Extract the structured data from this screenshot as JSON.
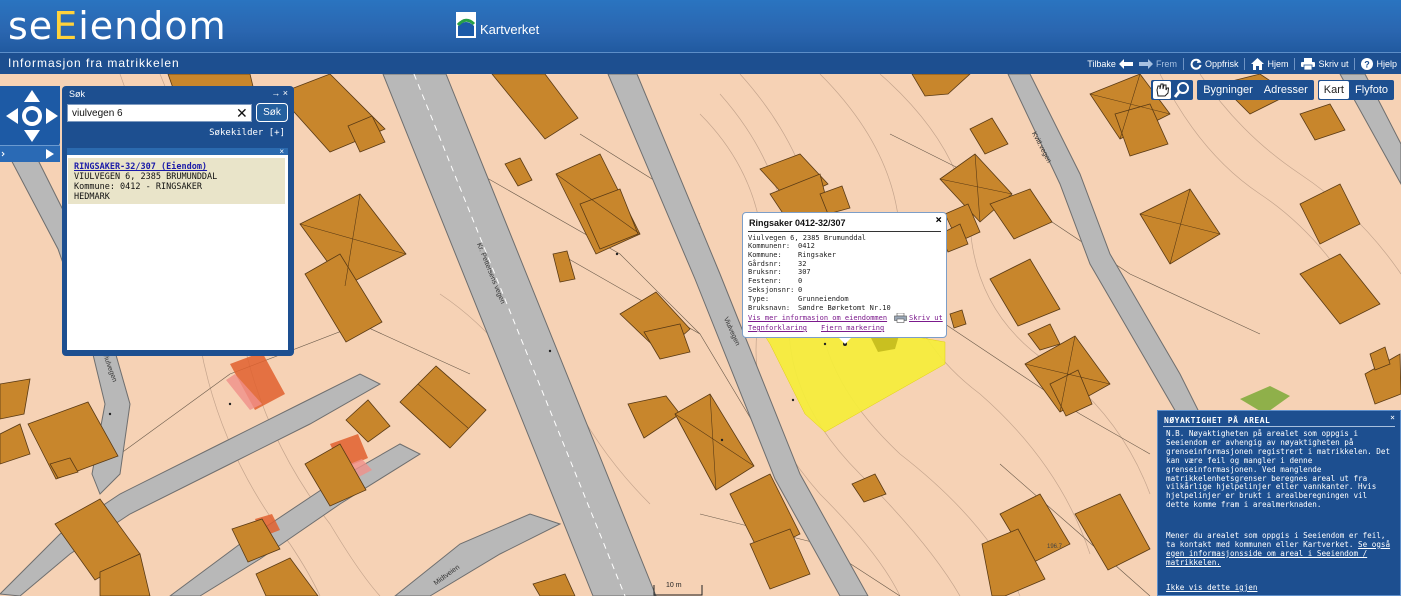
{
  "header": {
    "logo_pre": "se",
    "logo_accent": "E",
    "logo_post": "iendom",
    "partner": "Kartverket",
    "subtitle": "Informasjon fra matrikkelen"
  },
  "toolbar": {
    "back": "Tilbake",
    "forward": "Frem",
    "refresh": "Oppfrisk",
    "home": "Hjem",
    "print": "Skriv ut",
    "help": "Hjelp"
  },
  "view_controls": {
    "buildings": "Bygninger",
    "addresses": "Adresser",
    "map": "Kart",
    "aerial": "Flyfoto",
    "active_base": "Kart"
  },
  "search": {
    "title": "Søk",
    "window_controls": "→ ×",
    "query": "viulvegen 6",
    "button": "Søk",
    "sources": "Søkekilder [+]",
    "results_close": "×",
    "result": {
      "link": "RINGSAKER-32/307 (Eiendom)",
      "address": "VIULVEGEN 6, 2385 BRUMUNDDAL",
      "municipality": "Kommune: 0412 - RINGSAKER",
      "county": "HEDMARK"
    }
  },
  "popup": {
    "title": "Ringsaker 0412-32/307",
    "close": "×",
    "address": "Viulvegen 6, 2385 Brumunddal",
    "fields": [
      {
        "k": "Kommunenr:",
        "v": "0412"
      },
      {
        "k": "Kommune:",
        "v": "Ringsaker"
      },
      {
        "k": "Gårdsnr:",
        "v": "32"
      },
      {
        "k": "Bruksnr:",
        "v": "307"
      },
      {
        "k": "Festenr:",
        "v": "0"
      },
      {
        "k": "Seksjonsnr:",
        "v": "0"
      },
      {
        "k": "Type:",
        "v": "Grunneiendom"
      },
      {
        "k": "Bruksnavn:",
        "v": "Søndre Børketomt Nr.10"
      }
    ],
    "more_info": "Vis mer informasjon om eiendommen",
    "print": "Skriv ut",
    "legend": "Tegnforklaring",
    "remove_marking": "Fjern markering"
  },
  "notice": {
    "title": "NØYAKTIGHET PÅ AREAL",
    "close": "×",
    "p1": "N.B. Nøyaktigheten på arealet som oppgis i Seeiendom er avhengig av nøyaktigheten på grenseinformasjonen registrert i matrikkelen. Det kan være feil og mangler i denne grenseinformasjonen. Ved manglende matrikkelenhetsgrenser beregnes areal ut fra vilkårlige hjelpelinjer eller vannkanter. Hvis hjelpelinjer er brukt i arealberegningen vil dette komme fram i arealmerknaden.",
    "p2": "Mener du arealet som oppgis i Seeiendom er feil, ta kontakt med kommunen eller Kartverket. ",
    "p2_link": "Se også egen informasjonsside om areal i Seeiendom / matrikkelen.",
    "dismiss": "Ikke vis dette igjen"
  },
  "map_labels": {
    "road_1": "Kr. Pettersens vegen",
    "road_2": "Viulvegen",
    "road_3": "Kvitl.vegen",
    "road_4": "Viulvegen",
    "road_5": "Midtveien",
    "elevation": "196.7",
    "scale": "10 m"
  },
  "colors": {
    "header": "#2a6ab5",
    "map_bg": "#f6d2b5",
    "building": "#c8862c",
    "road": "#b8b8b8",
    "highlight": "#f6ee3a"
  }
}
